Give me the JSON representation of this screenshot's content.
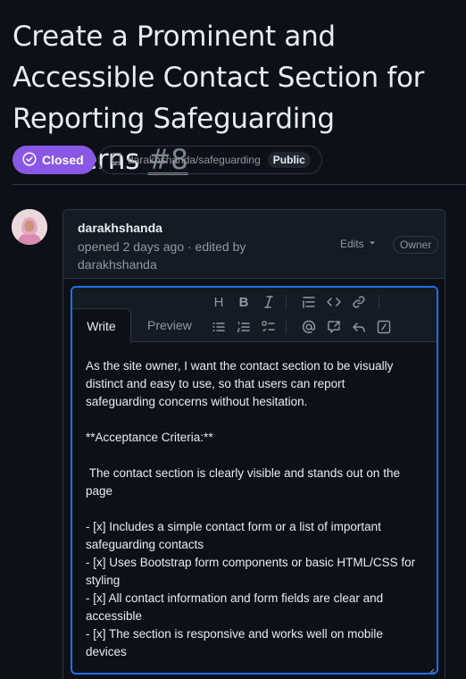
{
  "issue": {
    "title": "Create a Prominent and Accessible Contact Section for Reporting Safeguarding Concerns",
    "number": "#8",
    "state_label": "Closed",
    "repo": "darakhshanda/safeguarding",
    "visibility": "Public"
  },
  "comment": {
    "author": "darakhshanda",
    "meta": "opened 2 days ago · edited by darakhshanda",
    "edits_label": "Edits",
    "role_badge": "Owner"
  },
  "editor": {
    "tabs": {
      "write": "Write",
      "preview": "Preview"
    },
    "toolbar": [
      "heading-icon",
      "bold-icon",
      "italic-icon",
      "quote-icon",
      "code-icon",
      "link-icon",
      "unordered-list-icon",
      "ordered-list-icon",
      "task-list-icon",
      "mention-icon",
      "reference-icon",
      "saved-reply-icon",
      "slash-command-icon"
    ],
    "body": "As the site owner, I want the contact section to be visually distinct and easy to use, so that users can report safeguarding concerns without hesitation.\n\n**Acceptance Criteria:**\n\n The contact section is clearly visible and stands out on the page\n\n- [x] Includes a simple contact form or a list of important safeguarding contacts\n- [x] Uses Bootstrap form components or basic HTML/CSS for styling\n- [x] All contact information and form fields are clear and accessible\n- [x] The section is responsive and works well on mobile devices"
  },
  "colors": {
    "closed": "#8957e5",
    "focus": "#1f6feb",
    "bg": "#0d1117"
  }
}
